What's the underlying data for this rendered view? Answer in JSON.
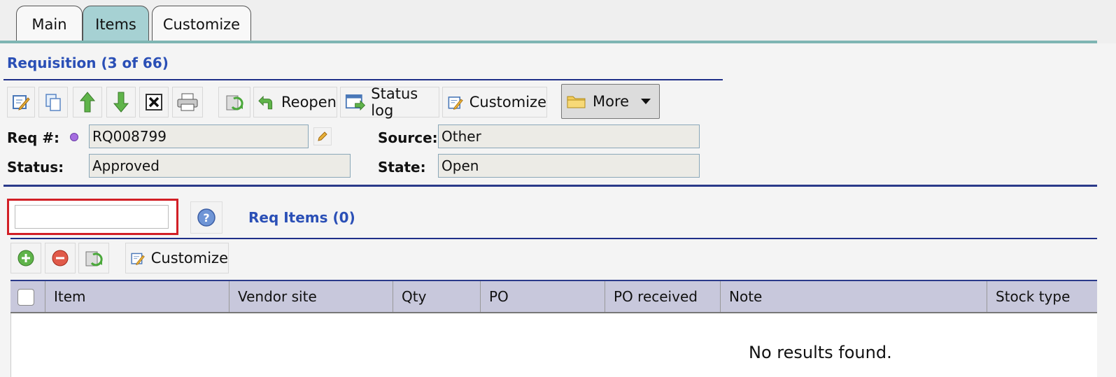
{
  "tabs": [
    {
      "label": "Main",
      "active": false
    },
    {
      "label": "Items",
      "active": true
    },
    {
      "label": "Customize",
      "active": false
    }
  ],
  "header": {
    "title": "Requisition (3 of 66)"
  },
  "toolbar": {
    "reopen_label": "Reopen",
    "status_log_label": "Status log",
    "customize_label": "Customize",
    "more_label": "More"
  },
  "fields": {
    "req_label": "Req #:",
    "req_value": "RQ008799",
    "status_label": "Status:",
    "status_value": "Approved",
    "source_label": "Source:",
    "source_value": "Other",
    "state_label": "State:",
    "state_value": "Open"
  },
  "items_section": {
    "title": "Req Items (0)",
    "search_value": "",
    "customize_label": "Customize"
  },
  "grid": {
    "columns": [
      "Item",
      "Vendor site",
      "Qty",
      "PO",
      "PO received",
      "Note",
      "Stock type"
    ],
    "empty_text": "No results found."
  },
  "colors": {
    "accent_blue": "#2a4fb6",
    "tab_active": "#a6d1d3",
    "highlight_red": "#d21f26",
    "grid_header": "#c8c8dc"
  }
}
